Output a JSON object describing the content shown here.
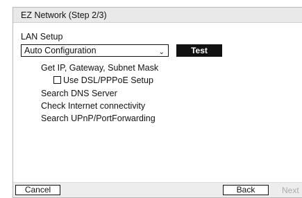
{
  "window": {
    "title": "EZ Network (Step 2/3)"
  },
  "lan_setup": {
    "label": "LAN Setup",
    "configuration_selected": "Auto Configuration",
    "test_button": "Test"
  },
  "steps": [
    "Get IP, Gateway, Subnet Mask",
    "Use DSL/PPPoE Setup",
    "Search DNS Server",
    "Check Internet connectivity",
    "Search UPnP/PortForwarding"
  ],
  "dsl_pppoe_checked": false,
  "icons": {
    "dropdown": "chevron-down-icon"
  },
  "buttons": {
    "cancel": "Cancel",
    "back": "Back",
    "next": "Next"
  },
  "colors": {
    "title_bar": "#e9e9e9",
    "bottom_bar": "#ededed",
    "test_button": "#111111",
    "disabled_text": "#aaaaaa"
  }
}
